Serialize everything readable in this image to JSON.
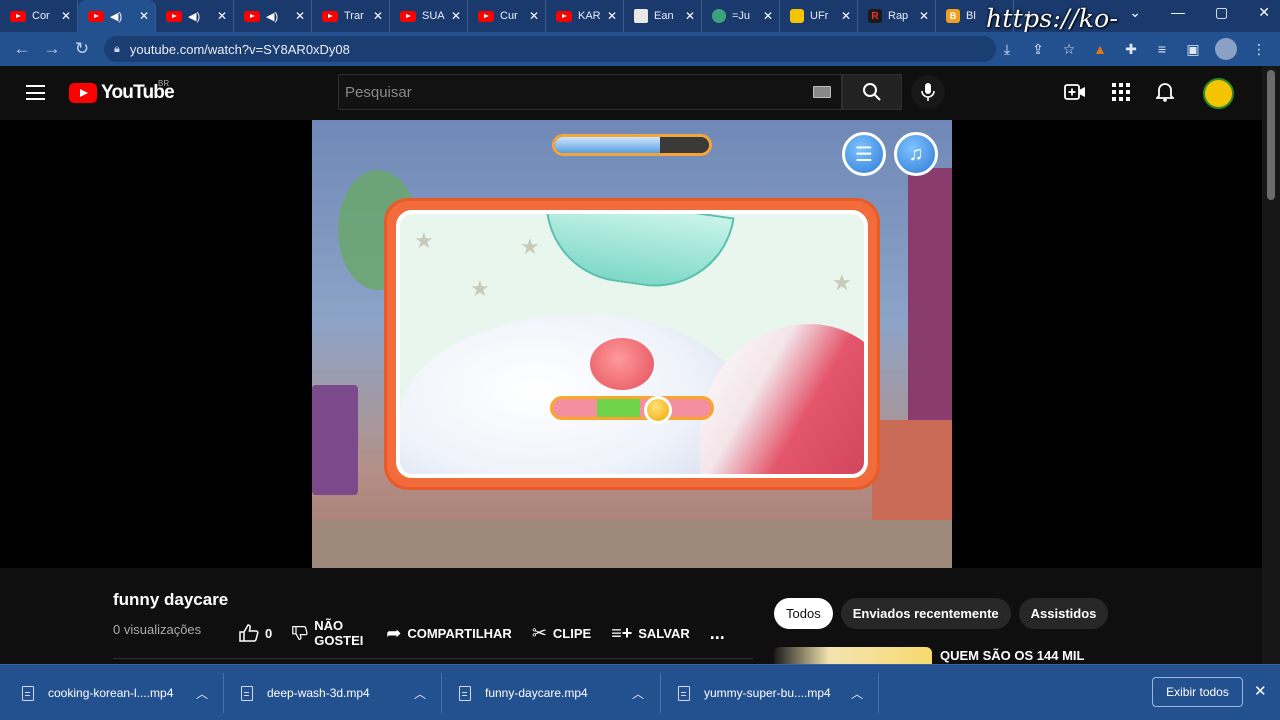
{
  "browser": {
    "tabs": [
      {
        "label": "Cor",
        "icon": "youtube-icon",
        "audio": false
      },
      {
        "label": "",
        "icon": "youtube-icon",
        "audio": true
      },
      {
        "label": "",
        "icon": "youtube-icon",
        "audio": true
      },
      {
        "label": "",
        "icon": "youtube-icon",
        "audio": true
      },
      {
        "label": "Trar",
        "icon": "youtube-icon",
        "audio": false
      },
      {
        "label": "SUA",
        "icon": "youtube-icon",
        "audio": false
      },
      {
        "label": "Cur",
        "icon": "youtube-icon",
        "audio": false
      },
      {
        "label": "KAR",
        "icon": "youtube-icon",
        "audio": false
      },
      {
        "label": "Ean",
        "icon": "document-icon",
        "audio": false
      },
      {
        "label": "=Ju",
        "icon": "globe-icon",
        "audio": false
      },
      {
        "label": "UFr",
        "icon": "page-icon",
        "audio": false
      },
      {
        "label": "Rap",
        "icon": "r-icon",
        "audio": false
      },
      {
        "label": "Bl",
        "icon": "blogger-icon",
        "audio": false
      }
    ],
    "new_tab_symbol": "+",
    "watermark": "https://ko-fi.com/gokagen",
    "url": "youtube.com/watch?v=SY8AR0xDy08"
  },
  "youtube": {
    "logo_text": "YouTube",
    "region": "BR",
    "search_placeholder": "Pesquisar",
    "video": {
      "title": "funny daycare",
      "views": "0 visualizações",
      "likes": "0",
      "dislike_label": "NÃO GOSTEI",
      "share_label": "COMPARTILHAR",
      "clip_label": "CLIPE",
      "save_label": "SALVAR",
      "more_label": "..."
    },
    "game": {
      "top_progress": 0.68,
      "meter_green_start": 0.28,
      "meter_green_end": 0.55,
      "knob_position": 0.66
    },
    "chips": [
      "Todos",
      "Enviados recentemente",
      "Assistidos"
    ],
    "recommended_title": "QUEM SÃO OS 144 MIL"
  },
  "downloads": {
    "items": [
      "cooking-korean-l....mp4",
      "deep-wash-3d.mp4",
      "funny-daycare.mp4",
      "yummy-super-bu....mp4"
    ],
    "show_all": "Exibir todos"
  },
  "colors": {
    "chrome_blue": "#23508f",
    "tabstrip_blue": "#1a3a6e",
    "youtube_red": "#ff0000",
    "page_bg": "#0f0f0f"
  }
}
